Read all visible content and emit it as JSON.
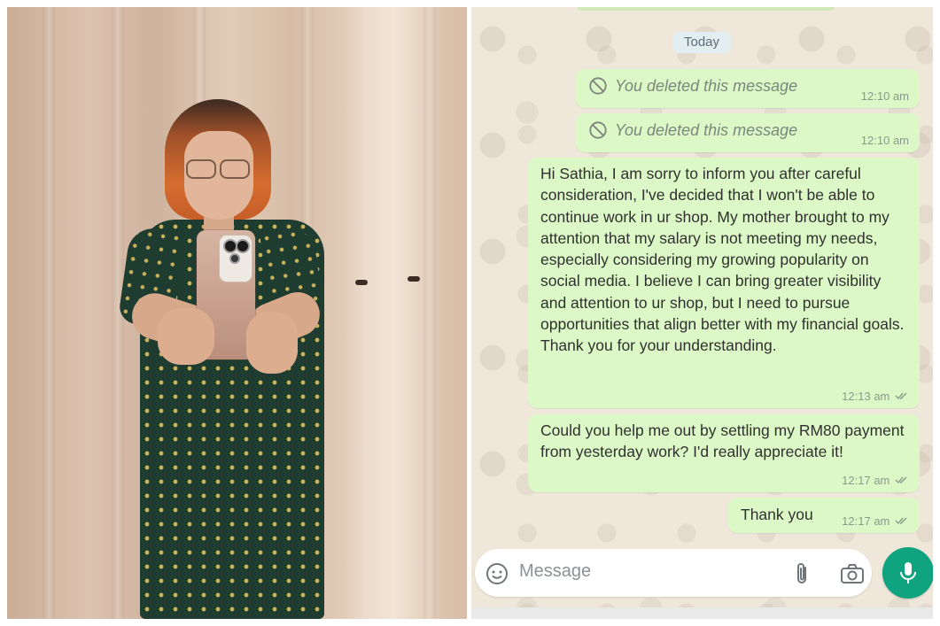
{
  "photo": {
    "alt_subject": "selfie-in-mirror"
  },
  "chat": {
    "date_chip": "Today",
    "messages": [
      {
        "type": "deleted",
        "text": "You deleted this message",
        "time": "12:10 am"
      },
      {
        "type": "deleted",
        "text": "You deleted this message",
        "time": "12:10 am"
      },
      {
        "type": "text",
        "text": "Hi Sathia, I am sorry to inform you after careful consideration, I've decided that I won't be able to continue work in ur shop. My mother brought to my attention that my salary is not meeting my needs, especially considering my growing popularity on social media. I believe I can bring greater visibility and attention to ur shop, but I need to pursue opportunities that align better with my financial goals. Thank you for your understanding.",
        "time": "12:13 am",
        "status": "read"
      },
      {
        "type": "text",
        "text": "Could you help me out by settling my RM80 payment from yesterday work? I'd really appreciate it!",
        "time": "12:17 am",
        "status": "read"
      },
      {
        "type": "text",
        "text": "Thank you",
        "time": "12:17 am",
        "status": "read"
      }
    ],
    "input": {
      "placeholder": "Message"
    },
    "icons": {
      "emoji": "emoji-icon",
      "attach": "paperclip-icon",
      "camera": "camera-icon",
      "mic": "microphone-icon",
      "deleted": "ban-icon",
      "ticks": "double-check-icon"
    },
    "colors": {
      "bubble_out": "#dcf8c6",
      "mic_button": "#10a37f",
      "chat_background": "#efe7da"
    }
  }
}
